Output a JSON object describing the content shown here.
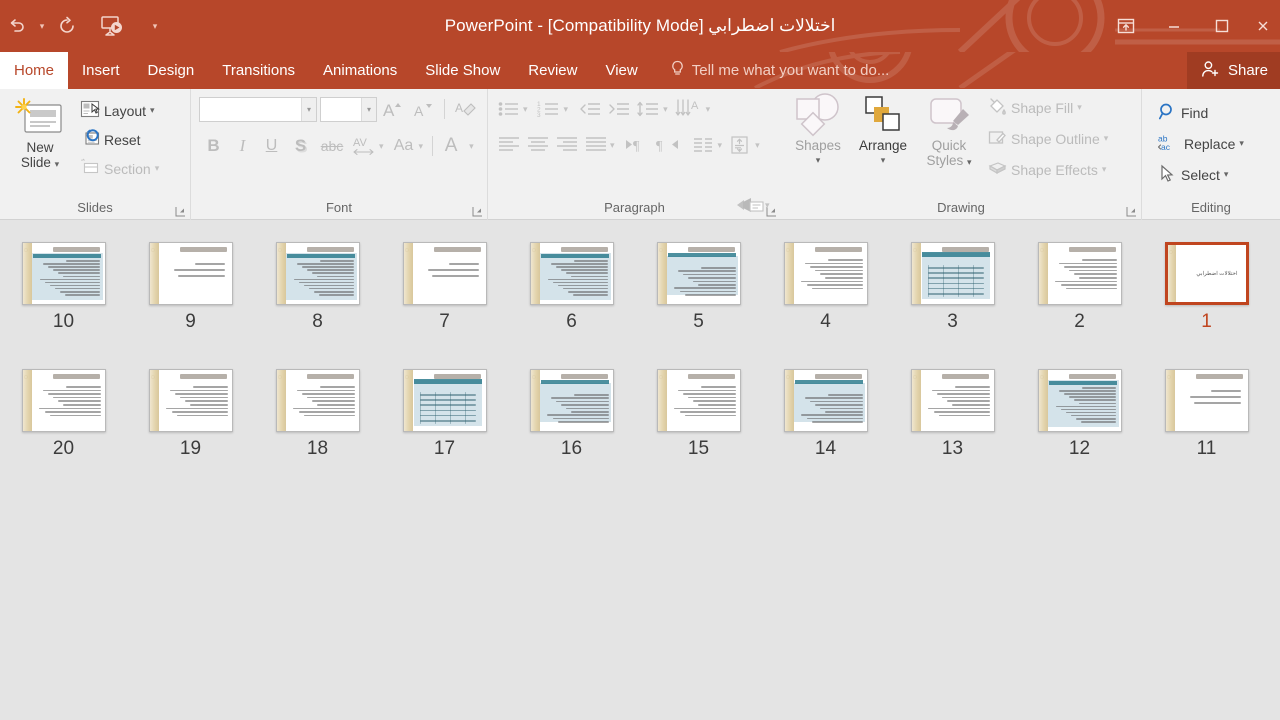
{
  "window": {
    "title": "اختلالات اضطرابي [Compatibility Mode] - PowerPoint",
    "accent_color": "#b7472a",
    "canvas_color": "#e4e4e4",
    "selection_color": "#c0451f"
  },
  "quick_access": {
    "undo_label": "Undo",
    "undo_caret": "▾",
    "redo_label": "Redo",
    "present_label": "Start From Beginning",
    "customize_caret": "▾"
  },
  "window_controls": {
    "ribbon_display": "Ribbon Display Options",
    "minimize": "Minimize",
    "restore": "Restore Down",
    "close": "Close"
  },
  "tabs": [
    {
      "label": "Home",
      "active": true
    },
    {
      "label": "Insert",
      "active": false
    },
    {
      "label": "Design",
      "active": false
    },
    {
      "label": "Transitions",
      "active": false
    },
    {
      "label": "Animations",
      "active": false
    },
    {
      "label": "Slide Show",
      "active": false
    },
    {
      "label": "Review",
      "active": false
    },
    {
      "label": "View",
      "active": false
    }
  ],
  "tell_me": {
    "placeholder": "Tell me what you want to do...",
    "icon": "lightbulb-icon"
  },
  "share": {
    "label": "Share",
    "icon": "person-add-icon"
  },
  "ribbon": {
    "groups": [
      {
        "name": "Slides",
        "label": "Slides",
        "new_slide": {
          "label_line1": "New",
          "label_line2": "Slide",
          "caret": "▾"
        },
        "layout": {
          "label": "Layout",
          "caret": "▾",
          "disabled": false
        },
        "reset": {
          "label": "Reset",
          "disabled": false
        },
        "section": {
          "label": "Section",
          "caret": "▾",
          "disabled": true
        }
      },
      {
        "name": "Font",
        "label": "Font",
        "font_name": {
          "value": "",
          "placeholder": ""
        },
        "font_size": {
          "value": "",
          "placeholder": ""
        },
        "grow_font": "A",
        "shrink_font": "A",
        "clear_formatting": "Clear All Formatting",
        "bold": "B",
        "italic": "I",
        "underline": "U",
        "shadow": "S",
        "strikethrough": "abc",
        "character_spacing": "AV",
        "change_case": "Aa",
        "font_color": "A"
      },
      {
        "name": "Paragraph",
        "label": "Paragraph",
        "bullets": "Bullets",
        "numbering": "Numbering",
        "decrease_indent": "Decrease List Level",
        "increase_indent": "Increase List Level",
        "line_spacing": "Line Spacing",
        "text_direction": "Text Direction",
        "align_left": "Align Left",
        "center": "Center",
        "align_right": "Align Right",
        "justify": "Justify",
        "ltr": "Left-to-Right",
        "rtl": "Right-to-Left",
        "columns": "Columns",
        "align_text": "Align Text",
        "convert_smartart": "Convert to SmartArt"
      },
      {
        "name": "Drawing",
        "label": "Drawing",
        "shapes": {
          "label": "Shapes",
          "caret": "▾"
        },
        "arrange": {
          "label": "Arrange",
          "caret": "▾"
        },
        "quick_styles": {
          "label_line1": "Quick",
          "label_line2": "Styles",
          "caret": "▾"
        },
        "shape_fill": {
          "label": "Shape Fill",
          "caret": "▾"
        },
        "shape_outline": {
          "label": "Shape Outline",
          "caret": "▾"
        },
        "shape_effects": {
          "label": "Shape Effects",
          "caret": "▾"
        }
      },
      {
        "name": "Editing",
        "label": "Editing",
        "find": {
          "label": "Find",
          "icon": "magnifier-icon"
        },
        "replace": {
          "label": "Replace",
          "caret": "▾",
          "icon": "replace-abac-icon"
        },
        "select": {
          "label": "Select",
          "caret": "▾",
          "icon": "cursor-arrow-icon"
        }
      }
    ]
  },
  "slide_sorter": {
    "selected_slide": 1,
    "rows": [
      [
        {
          "number": "10",
          "kind": "panel-list",
          "selected": false
        },
        {
          "number": "9",
          "kind": "text-short",
          "selected": false
        },
        {
          "number": "8",
          "kind": "panel-list",
          "selected": false
        },
        {
          "number": "7",
          "kind": "text-short",
          "selected": false
        },
        {
          "number": "6",
          "kind": "panel-list",
          "selected": false
        },
        {
          "number": "5",
          "kind": "panel-band",
          "selected": false
        },
        {
          "number": "4",
          "kind": "text-dense",
          "selected": false
        },
        {
          "number": "3",
          "kind": "table",
          "selected": false
        },
        {
          "number": "2",
          "kind": "text-dense",
          "selected": false
        },
        {
          "number": "1",
          "kind": "title",
          "selected": true,
          "title_text": "اختلالات اضطرابي"
        }
      ],
      [
        {
          "number": "20",
          "kind": "text-dense",
          "selected": false
        },
        {
          "number": "19",
          "kind": "text-dense",
          "selected": false
        },
        {
          "number": "18",
          "kind": "text-dense",
          "selected": false
        },
        {
          "number": "17",
          "kind": "table",
          "selected": false
        },
        {
          "number": "16",
          "kind": "panel-band",
          "selected": false
        },
        {
          "number": "15",
          "kind": "text-dense",
          "selected": false
        },
        {
          "number": "14",
          "kind": "panel-band",
          "selected": false
        },
        {
          "number": "13",
          "kind": "text-dense",
          "selected": false
        },
        {
          "number": "12",
          "kind": "panel-list",
          "selected": false
        },
        {
          "number": "11",
          "kind": "text-short",
          "selected": false
        }
      ]
    ]
  }
}
